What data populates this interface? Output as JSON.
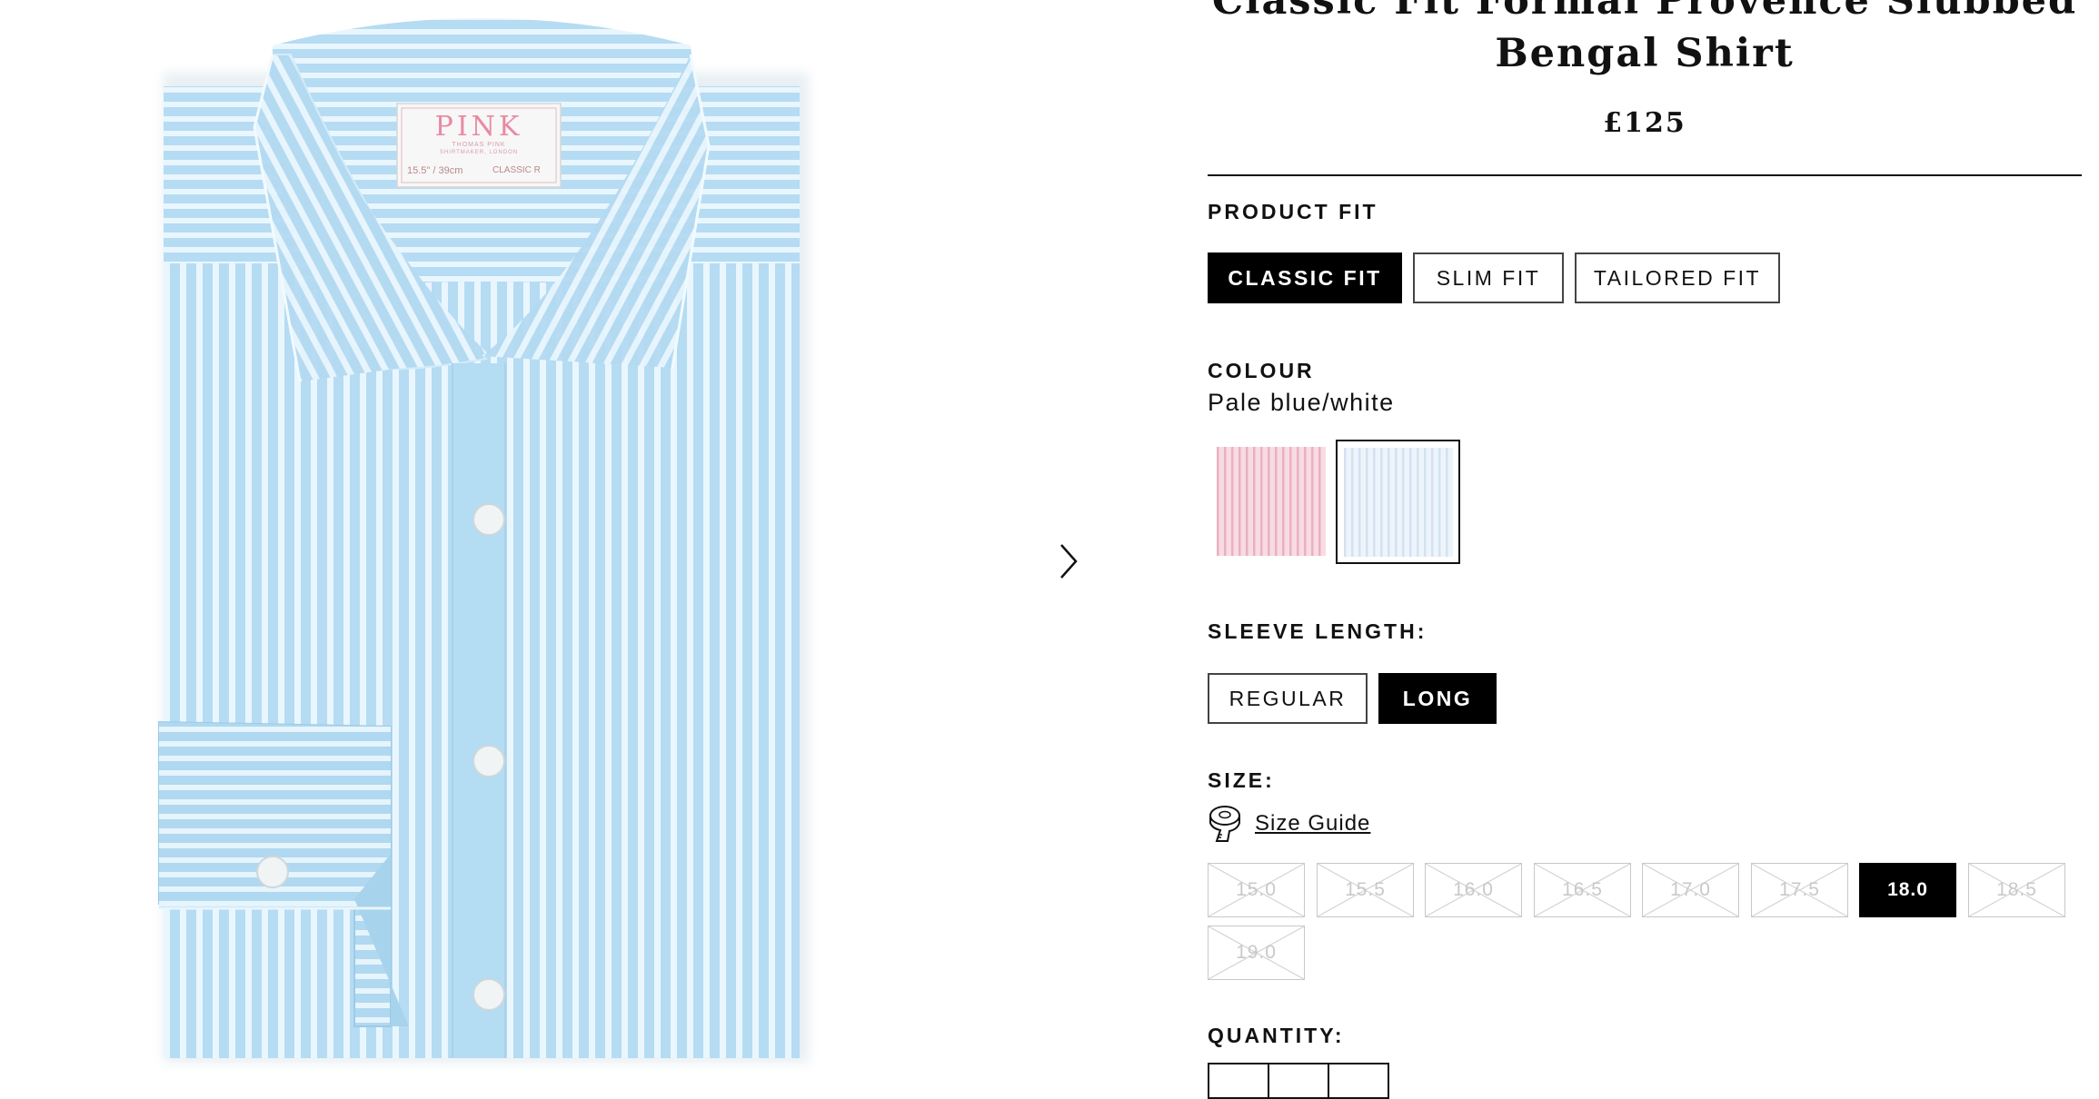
{
  "product": {
    "title": "Classic Fit Formal Provence Slubbed Bengal Shirt",
    "price": "£125",
    "image_label": {
      "brand": "PINK",
      "maker": "THOMAS PINK",
      "city": "SHIRTMAKER, LONDON",
      "size": "15.5\" / 39cm",
      "fit": "CLASSIC R"
    }
  },
  "product_fit": {
    "label": "PRODUCT FIT",
    "options": [
      "CLASSIC FIT",
      "SLIM FIT",
      "TAILORED FIT"
    ],
    "selected": "CLASSIC FIT"
  },
  "colour": {
    "label": "COLOUR",
    "selected_name": "Pale blue/white",
    "swatches": [
      {
        "name": "Pink/white",
        "color": "#f6d3dd",
        "stripe": "#e9a9bd",
        "selected": false
      },
      {
        "name": "Pale blue/white",
        "color": "#e9f1fb",
        "stripe": "#d2e1f3",
        "selected": true
      }
    ]
  },
  "sleeve_length": {
    "label": "SLEEVE LENGTH:",
    "options": [
      "REGULAR",
      "LONG"
    ],
    "selected": "LONG"
  },
  "size": {
    "label": "SIZE:",
    "guide_label": "Size Guide",
    "options": [
      {
        "value": "15.0",
        "available": false
      },
      {
        "value": "15.5",
        "available": false
      },
      {
        "value": "16.0",
        "available": false
      },
      {
        "value": "16.5",
        "available": false
      },
      {
        "value": "17.0",
        "available": false
      },
      {
        "value": "17.5",
        "available": false
      },
      {
        "value": "18.0",
        "available": true,
        "selected": true
      },
      {
        "value": "18.5",
        "available": false
      },
      {
        "value": "19.0",
        "available": false
      }
    ]
  },
  "quantity": {
    "label": "QUANTITY:"
  },
  "colors": {
    "shirt_base": "#b7ddf3",
    "shirt_stripe": "#e9f5fc",
    "selected_bg": "#000000"
  }
}
